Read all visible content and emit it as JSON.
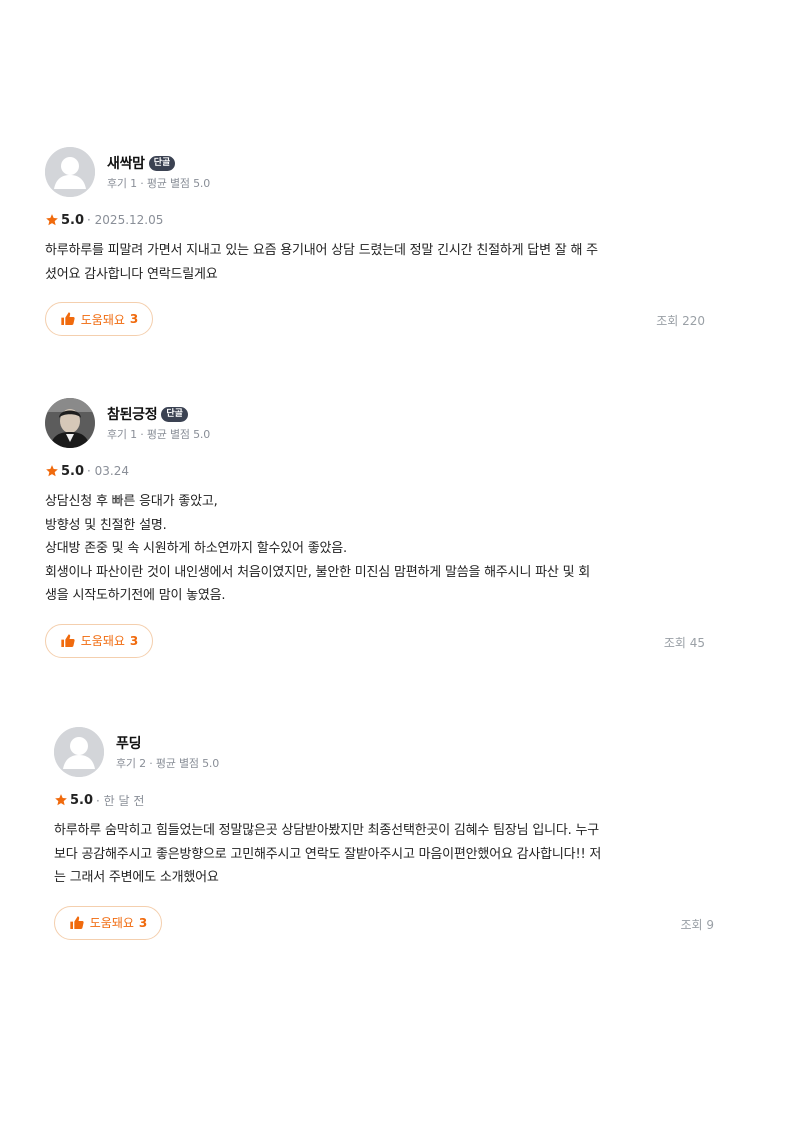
{
  "colors": {
    "accent": "#f06a0d",
    "badge_bg": "#3b4252",
    "muted": "#8a8f98"
  },
  "reviews": [
    {
      "author": "새싹맘",
      "badge": "단골",
      "meta": "후기 1 · 평균 별점 5.0",
      "score": "5.0",
      "date": "· 2025.12.05",
      "text": "하루하루를 피말려 가면서 지내고 있는 요즘 용기내어 상담 드렸는데 정말 긴시간 친절하게 답변 잘 해 주\n셨어요 감사합니다 연락드릴게요",
      "helpful_label": "도움돼요",
      "helpful_count": "3",
      "views": "조회 220",
      "avatar_icon": "default-avatar-icon"
    },
    {
      "author": "참된긍정",
      "badge": "단골",
      "meta": "후기 1 · 평균 별점 5.0",
      "score": "5.0",
      "date": "· 03.24",
      "text": "상담신청 후 빠른 응대가 좋았고,\n방향성 및 친절한 설명.\n상대방 존중 및 속 시원하게 하소연까지 할수있어 좋았음.\n회생이나 파산이란 것이 내인생에서 처음이였지만, 불안한 미진심 맘편하게 말씀을 해주시니 파산 및 회\n생을 시작도하기전에 맘이 놓였음.",
      "helpful_label": "도움돼요",
      "helpful_count": "3",
      "views": "조회 45",
      "avatar_icon": "profile-photo"
    },
    {
      "author": "푸딩",
      "badge": "",
      "meta": "후기 2 · 평균 별점 5.0",
      "score": "5.0",
      "date": "· 한 달 전",
      "text": "하루하루 숨막히고 힘들었는데 정말많은곳 상담받아봤지만 최종선택한곳이 김혜수 팀장님 입니다. 누구\n보다 공감해주시고 좋은방향으로 고민해주시고 연락도 잘받아주시고 마음이편안했어요 감사합니다!! 저\n는 그래서 주변에도 소개했어요",
      "helpful_label": "도움돼요",
      "helpful_count": "3",
      "views": "조회 9",
      "avatar_icon": "default-avatar-icon"
    }
  ]
}
